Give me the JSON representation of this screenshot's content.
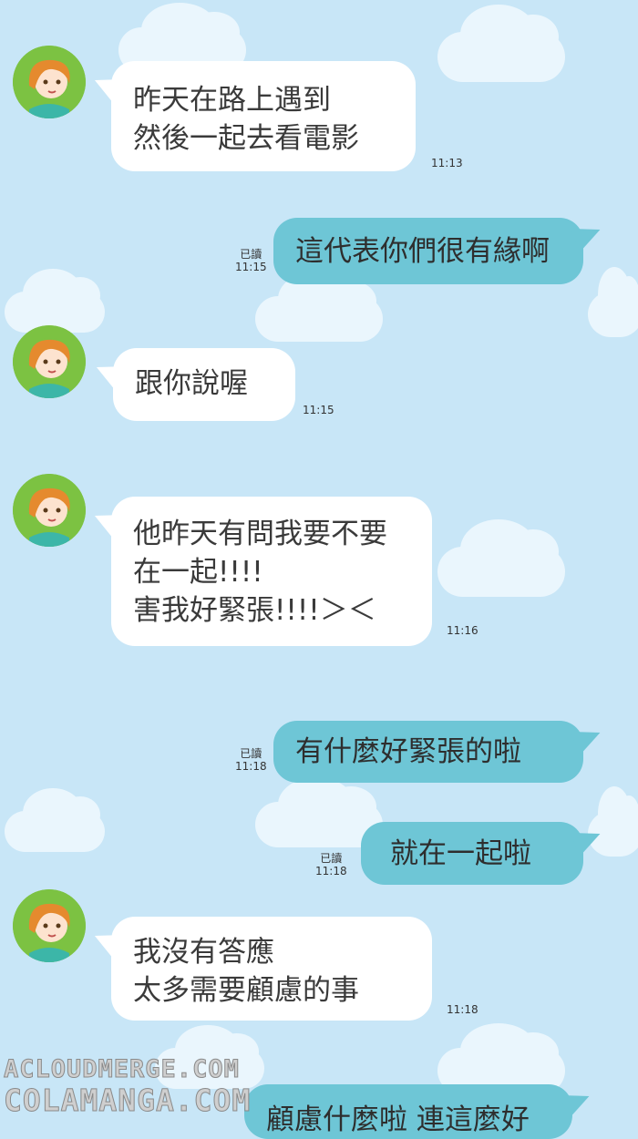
{
  "messages": [
    {
      "side": "in",
      "text": "昨天在路上遇到\n然後一起去看電影",
      "time": "11:13"
    },
    {
      "side": "out",
      "text": "這代表你們很有緣啊",
      "read": "已讀",
      "time": "11:15"
    },
    {
      "side": "in",
      "text": "跟你說喔",
      "time": "11:15"
    },
    {
      "side": "in",
      "text": "他昨天有問我要不要\n在一起!!!!\n害我好緊張!!!!＞＜",
      "time": "11:16"
    },
    {
      "side": "out",
      "text": "有什麼好緊張的啦",
      "read": "已讀",
      "time": "11:18"
    },
    {
      "side": "out",
      "text": "就在一起啦",
      "read": "已讀",
      "time": "11:18"
    },
    {
      "side": "in",
      "text": "我沒有答應\n太多需要顧慮的事",
      "time": "11:18"
    },
    {
      "side": "out",
      "text": "顧慮什麼啦 連這麼好"
    }
  ],
  "watermark": {
    "line1": "ACLOUDMERGE.COM",
    "line2": "COLAMANGA.COM"
  },
  "colors": {
    "background": "#c8e6f7",
    "incoming": "#ffffff",
    "outgoing": "#6ec6d6",
    "avatar": "#7cc242"
  }
}
